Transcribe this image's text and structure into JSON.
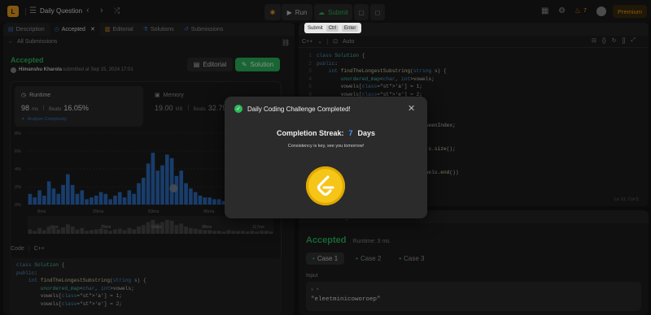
{
  "topbar": {
    "title": "Daily Question",
    "run": "Run",
    "submit": "Submit",
    "streak_count": "7",
    "premium": "Premium"
  },
  "tooltip": {
    "label": "Submit",
    "key1": "Ctrl",
    "key2": "Enter"
  },
  "left_tabs": [
    {
      "label": "Description",
      "icon": "description-icon"
    },
    {
      "label": "Accepted",
      "icon": "accepted-icon"
    },
    {
      "label": "Editorial",
      "icon": "editorial-icon"
    },
    {
      "label": "Solutions",
      "icon": "solutions-icon"
    },
    {
      "label": "Submissions",
      "icon": "submissions-icon"
    }
  ],
  "submission": {
    "back_label": "All Submissions",
    "status": "Accepted",
    "user": "Himanshu Kharola",
    "submitted": "submitted at Sep 15, 2024 17:01",
    "editorial_btn": "Editorial",
    "solution_btn": "Solution",
    "runtime_label": "Runtime",
    "runtime_value": "98",
    "runtime_unit": "ms",
    "beats_label": "Beats",
    "runtime_beats": "16.05%",
    "analyze": "Analyze Complexity",
    "memory_label": "Memory",
    "memory_value": "19.00",
    "memory_unit": "MB",
    "memory_beats": "32.79",
    "code_label": "Code",
    "code_lang": "C++"
  },
  "chart_data": {
    "type": "bar",
    "y_ticks": [
      "8%",
      "6%",
      "4%",
      "2%",
      "0%"
    ],
    "ylim": [
      0,
      8
    ],
    "x_ticks": [
      "8ms",
      "29ms",
      "63ms",
      "96ms",
      "117ms"
    ],
    "bars": [
      1.2,
      0.8,
      1.6,
      1.0,
      2.6,
      1.8,
      1.2,
      2.2,
      3.4,
      2.2,
      1.2,
      1.6,
      0.6,
      0.8,
      1.0,
      1.4,
      1.2,
      0.6,
      1.0,
      1.4,
      0.8,
      1.6,
      1.2,
      2.4,
      3.0,
      4.6,
      5.8,
      3.8,
      4.4,
      5.6,
      5.2,
      3.2,
      3.8,
      2.4,
      1.8,
      1.4,
      1.0,
      0.8,
      0.8,
      0.6,
      0.6,
      0.4,
      0.8,
      0.6,
      0.5,
      0.5,
      0.4,
      0.5,
      0.4,
      0.5,
      0.5,
      0.4
    ],
    "mini_bars": [
      0.6,
      0.4,
      0.8,
      0.5,
      1.0,
      0.8,
      0.6,
      0.9,
      1.3,
      1.0,
      0.6,
      0.8,
      0.4,
      0.5,
      0.6,
      0.7,
      0.6,
      0.4,
      0.6,
      0.7,
      0.5,
      0.8,
      0.6,
      1.0,
      1.2,
      1.6,
      1.9,
      1.4,
      1.6,
      1.9,
      1.8,
      1.2,
      1.4,
      1.0,
      0.8,
      0.7,
      0.6,
      0.5,
      0.5,
      0.4,
      0.4,
      0.3,
      0.5,
      0.4,
      0.4,
      0.4,
      0.3,
      0.4,
      0.3,
      0.4,
      0.4,
      0.3
    ],
    "mini_ticks": [
      "0ms",
      "25ms",
      "63ms",
      "96ms",
      "117ms"
    ]
  },
  "editor": {
    "lang": "C++",
    "mode": "Auto",
    "footer": "Ln 12, Col 5",
    "lines": [
      "class Solution {",
      "public:",
      "    int findTheLongestSubstring(string s) {",
      "        unordered_map<char, int>vowels;",
      "        vowels['a'] = 1;",
      "        vowels['e'] = 2;",
      "",
      "",
      "",
      "                                    seenIndex;",
      "",
      "",
      "                                   = s.size();",
      "",
      "",
      "                                  vowels.end())"
    ]
  },
  "left_code": [
    "class Solution {",
    "public:",
    "    int findTheLongestSubstring(string s) {",
    "        unordered_map<char, int>vowels;",
    "        vowels['a'] = 1;",
    "        vowels['e'] = 2;"
  ],
  "result": {
    "tab1": "Testcase",
    "tab2": "Test Result",
    "status": "Accepted",
    "runtime": "Runtime: 3 ms",
    "cases": [
      "Case 1",
      "Case 2",
      "Case 3"
    ],
    "input_label": "Input",
    "input_var": "s =",
    "input_value": "\"eleetminicoworoep\""
  },
  "modal": {
    "title": "Daily Coding Challenge Completed!",
    "streak_label": "Completion Streak:",
    "streak_value": "7",
    "streak_unit": "Days",
    "message": "Consistency is key, see you tomorrow!"
  },
  "colors": {
    "accent_green": "#2cbb5d",
    "accent_blue": "#3b7bd6",
    "premium": "#ffa116",
    "coin": "#f5c518"
  }
}
